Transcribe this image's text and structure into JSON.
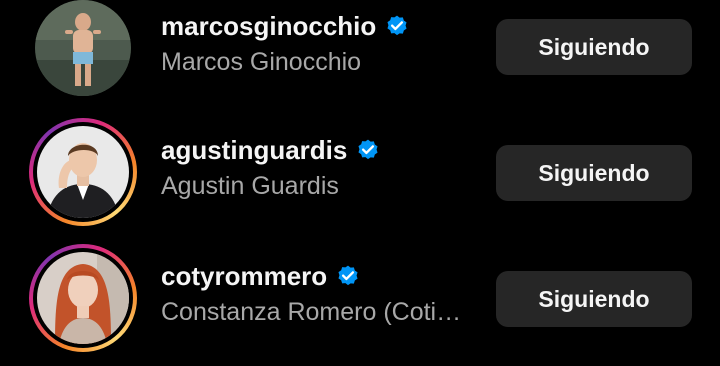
{
  "following_list": [
    {
      "username": "marcosginocchio",
      "full_name": "Marcos Ginocchio",
      "verified": true,
      "has_story_ring": false,
      "button_label": "Siguiendo"
    },
    {
      "username": "agustinguardis",
      "full_name": "Agustin Guardis",
      "verified": true,
      "has_story_ring": true,
      "button_label": "Siguiendo"
    },
    {
      "username": "cotyrommero",
      "full_name": "Constanza Romero (Coti…",
      "verified": true,
      "has_story_ring": true,
      "button_label": "Siguiendo"
    }
  ],
  "colors": {
    "background": "#000000",
    "button_bg": "#262626",
    "verified_blue": "#0095f6",
    "secondary_text": "#a8a8a8"
  }
}
